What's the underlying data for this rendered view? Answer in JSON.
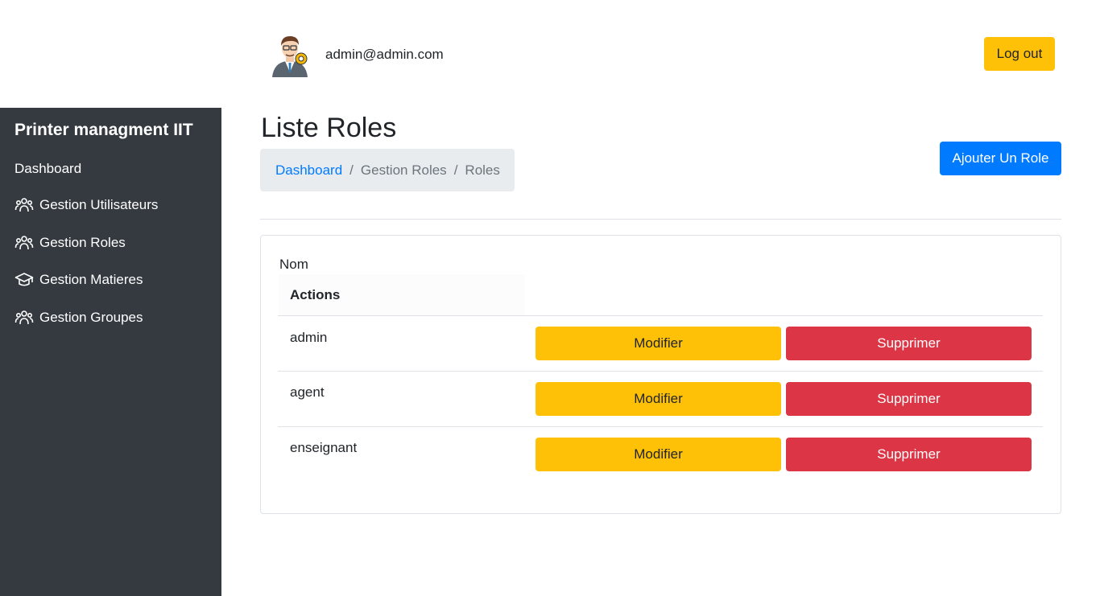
{
  "sidebar": {
    "brand": "Printer managment IIT",
    "items": [
      {
        "label": "Dashboard",
        "icon": "none"
      },
      {
        "label": "Gestion Utilisateurs",
        "icon": "users-icon"
      },
      {
        "label": "Gestion Roles",
        "icon": "users-icon"
      },
      {
        "label": "Gestion Matieres",
        "icon": "graduation-cap-icon"
      },
      {
        "label": "Gestion Groupes",
        "icon": "users-icon"
      }
    ]
  },
  "header": {
    "user_email": "admin@admin.com",
    "logout_label": "Log out"
  },
  "main": {
    "title": "Liste Roles",
    "breadcrumb": [
      "Dashboard",
      "Gestion Roles",
      "Roles"
    ],
    "add_button_label": "Ajouter Un Role",
    "table": {
      "header_name": "Nom",
      "header_actions": "Actions",
      "rows": [
        {
          "name": "admin",
          "edit_label": "Modifier",
          "delete_label": "Supprimer"
        },
        {
          "name": "agent",
          "edit_label": "Modifier",
          "delete_label": "Supprimer"
        },
        {
          "name": "enseignant",
          "edit_label": "Modifier",
          "delete_label": "Supprimer"
        }
      ]
    }
  },
  "colors": {
    "sidebar_bg": "#343a40",
    "warning": "#ffc107",
    "danger": "#dc3545",
    "primary": "#007bff",
    "breadcrumb_bg": "#e9ecef"
  }
}
